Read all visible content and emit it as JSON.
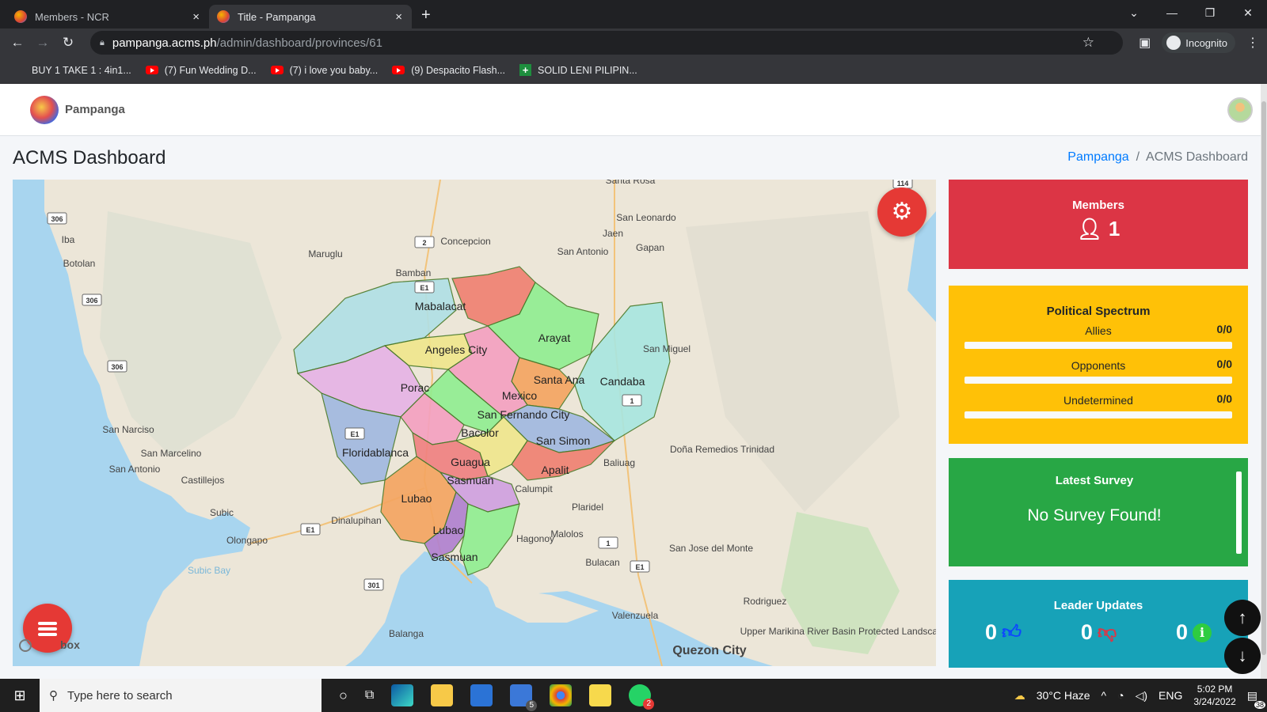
{
  "browser": {
    "tabs": [
      {
        "title": "Members - NCR",
        "close": "×"
      },
      {
        "title": "Title - Pampanga",
        "close": "×"
      }
    ],
    "new_tab": "+",
    "url_host": "pampanga.acms.ph",
    "url_path": "/admin/dashboard/provinces/61",
    "incognito_label": "Incognito",
    "bookmarks": [
      {
        "label": "BUY 1 TAKE 1 : 4in1...",
        "icon": "blank"
      },
      {
        "label": "(7) Fun Wedding D...",
        "icon": "youtube-icon"
      },
      {
        "label": "(7) i love you baby...",
        "icon": "youtube-icon"
      },
      {
        "label": "(9) Despacito Flash...",
        "icon": "youtube-icon"
      },
      {
        "label": "SOLID LENI PILIPIN...",
        "icon": "plus-icon"
      }
    ]
  },
  "app": {
    "brand": "Pampanga",
    "page_title": "ACMS Dashboard",
    "breadcrumb": {
      "parent": "Pampanga",
      "separator": "/",
      "current": "ACMS Dashboard"
    }
  },
  "map": {
    "attribution": "box",
    "provinces": [
      {
        "name": "Mabalacat",
        "color": "#b0e0e6"
      },
      {
        "name": "Angeles City",
        "color": "#f0e68c"
      },
      {
        "name": "Arayat",
        "color": "#90ee90"
      },
      {
        "name": "Porac",
        "color": "#e6b3e6"
      },
      {
        "name": "Santa Ana",
        "color": "#f4a460"
      },
      {
        "name": "Candaba",
        "color": "#a8e6e0"
      },
      {
        "name": "Mexico",
        "color": "#f4a0c0"
      },
      {
        "name": "San Fernando City",
        "color": "#90ee90"
      },
      {
        "name": "Floridablanca",
        "color": "#a0b8e0"
      },
      {
        "name": "Bacolor",
        "color": "#f4a0c0"
      },
      {
        "name": "San Simon",
        "color": "#a0b8e0"
      },
      {
        "name": "Guagua",
        "color": "#f08080"
      },
      {
        "name": "Apalit",
        "color": "#f08070"
      },
      {
        "name": "Sasmuan",
        "color": "#d0a0e0"
      },
      {
        "name": "Lubao",
        "color": "#f4a460"
      },
      {
        "name": "Lubao",
        "color": "#b080d0"
      },
      {
        "name": "Sasmuan",
        "color": "#90ee90"
      }
    ],
    "places": [
      "Santa Rosa",
      "San Leonardo",
      "Jaen",
      "Gapan",
      "San Antonio",
      "Concepcion",
      "Maruglu",
      "Bamban",
      "Iba",
      "Botolan",
      "San Miguel",
      "San Narciso",
      "San Marcelino",
      "San Antonio",
      "Castillejos",
      "Subic",
      "Olongapo",
      "Dinalupihan",
      "Subic Bay",
      "Calumpit",
      "Plaridel",
      "Hagonoy",
      "Malolos",
      "Baliuag",
      "Doña Remedios Trinidad",
      "Bulacan",
      "San Jose del Monte",
      "Rodriguez",
      "Valenzuela",
      "Balanga",
      "Quezon City",
      "Upper Marikina River Basin Protected Landscape"
    ],
    "shields": [
      "306",
      "306",
      "306",
      "2",
      "E1",
      "E1",
      "1",
      "E1",
      "1",
      "E1",
      "301",
      "114"
    ]
  },
  "cards": {
    "members": {
      "title": "Members",
      "value": "1",
      "icon": "user-icon"
    },
    "spectrum": {
      "title": "Political Spectrum",
      "rows": [
        {
          "label": "Allies",
          "value": "0/0",
          "fraction": 0
        },
        {
          "label": "Opponents",
          "value": "0/0",
          "fraction": 0
        },
        {
          "label": "Undetermined",
          "value": "0/0",
          "fraction": 0
        }
      ]
    },
    "survey": {
      "title": "Latest Survey",
      "message": "No Survey Found!"
    },
    "leaders": {
      "title": "Leader Updates",
      "items": [
        {
          "value": "0",
          "icon": "thumbs-up-icon",
          "color": "#0d47ff"
        },
        {
          "value": "0",
          "icon": "thumbs-down-icon",
          "color": "#dc3545"
        },
        {
          "value": "0",
          "icon": "info-icon",
          "color": "#2ecc40"
        }
      ]
    }
  },
  "colors": {
    "red": "#dc3545",
    "yellow": "#ffc107",
    "green": "#28a745",
    "teal": "#17a2b8",
    "fab": "#e53935"
  },
  "taskbar": {
    "search_placeholder": "Type here to search",
    "weather": "30°C  Haze",
    "lang": "ENG",
    "time": "5:02 PM",
    "date": "3/24/2022",
    "mail_badge": "5",
    "chrome_badge": "2",
    "notif_badge": "38"
  }
}
